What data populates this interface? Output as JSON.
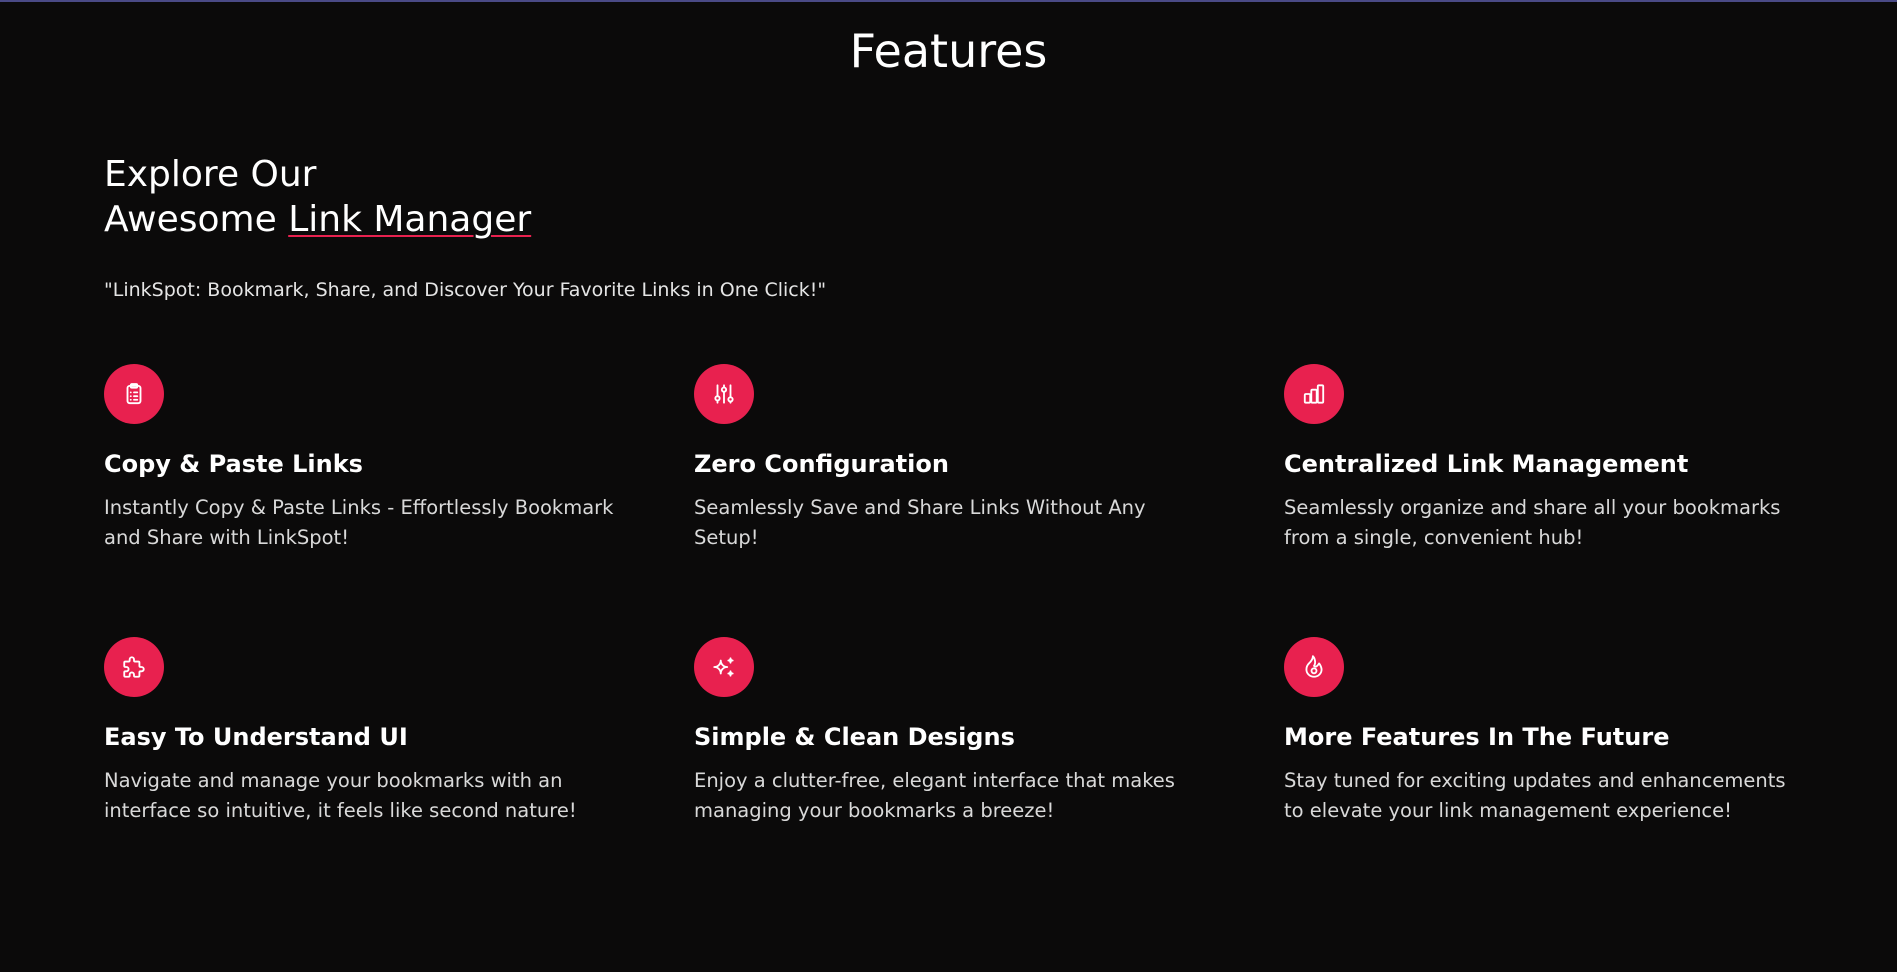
{
  "section": {
    "title": "Features"
  },
  "hero": {
    "headline_line1": "Explore Our",
    "headline_line2_prefix": "Awesome ",
    "headline_line2_highlight": "Link Manager",
    "tagline": "\"LinkSpot: Bookmark, Share, and Discover Your Favorite Links in One Click!\""
  },
  "colors": {
    "accent": "#e8214f",
    "background": "#0b0a0a",
    "top_line": "#4a4a86"
  },
  "features": [
    {
      "icon": "clipboard-list-icon",
      "title": "Copy & Paste Links",
      "description": "Instantly Copy & Paste Links - Effortlessly Bookmark and Share with LinkSpot!"
    },
    {
      "icon": "adjustments-icon",
      "title": "Zero Configuration",
      "description": "Seamlessly Save and Share Links Without Any Setup!"
    },
    {
      "icon": "bar-chart-icon",
      "title": "Centralized Link Management",
      "description": "Seamlessly organize and share all your bookmarks from a single, convenient hub!"
    },
    {
      "icon": "puzzle-icon",
      "title": "Easy To Understand UI",
      "description": "Navigate and manage your bookmarks with an interface so intuitive, it feels like second nature!"
    },
    {
      "icon": "sparkles-icon",
      "title": "Simple & Clean Designs",
      "description": "Enjoy a clutter-free, elegant interface that makes managing your bookmarks a breeze!"
    },
    {
      "icon": "flame-icon",
      "title": "More Features In The Future",
      "description": "Stay tuned for exciting updates and enhancements to elevate your link management experience!"
    }
  ]
}
